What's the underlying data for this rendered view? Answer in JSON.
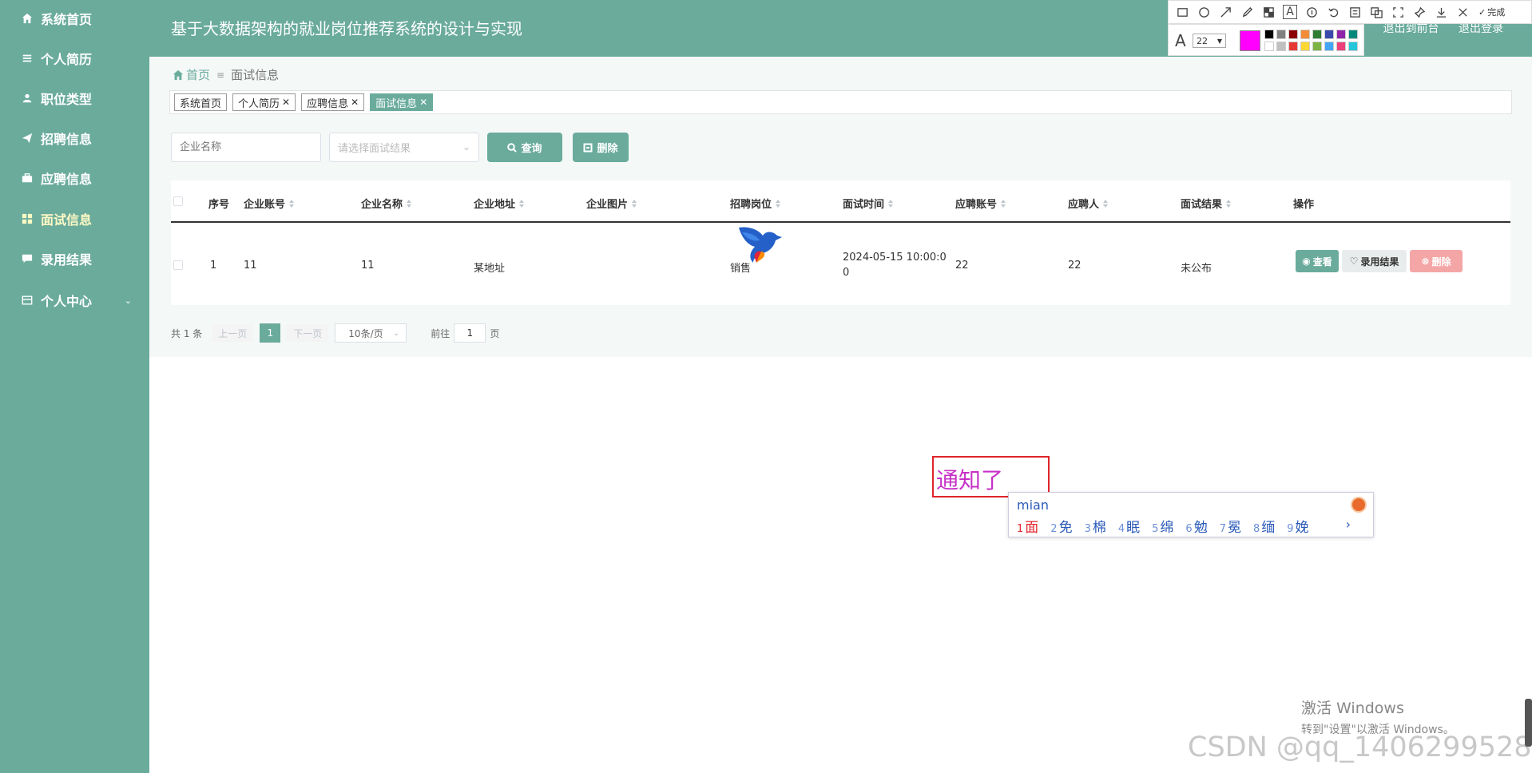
{
  "app": {
    "title": "基于大数据架构的就业岗位推荐系统的设计与实现",
    "header_links": [
      "退出到前台",
      "退出登录"
    ]
  },
  "sidebar": {
    "items": [
      {
        "label": "系统首页",
        "icon": "home-icon"
      },
      {
        "label": "个人简历",
        "icon": "list-icon"
      },
      {
        "label": "职位类型",
        "icon": "user-icon"
      },
      {
        "label": "招聘信息",
        "icon": "send-icon"
      },
      {
        "label": "应聘信息",
        "icon": "briefcase-icon"
      },
      {
        "label": "面试信息",
        "icon": "grid-icon",
        "active": true
      },
      {
        "label": "录用结果",
        "icon": "chat-icon"
      },
      {
        "label": "个人中心",
        "icon": "card-icon",
        "expandable": true
      }
    ]
  },
  "breadcrumb": {
    "home": "首页",
    "current": "面试信息"
  },
  "tags": [
    {
      "label": "系统首页",
      "closable": false
    },
    {
      "label": "个人简历",
      "closable": true
    },
    {
      "label": "应聘信息",
      "closable": true
    },
    {
      "label": "面试信息",
      "closable": true,
      "active": true
    }
  ],
  "search": {
    "company_placeholder": "企业名称",
    "result_placeholder": "请选择面试结果",
    "query_label": "查询",
    "delete_label": "删除"
  },
  "table": {
    "columns": [
      "序号",
      "企业账号",
      "企业名称",
      "企业地址",
      "企业图片",
      "招聘岗位",
      "面试时间",
      "应聘账号",
      "应聘人",
      "面试结果",
      "操作"
    ],
    "rows": [
      {
        "index": "1",
        "company_account": "11",
        "company_name": "11",
        "address": "某地址",
        "position": "销售",
        "time_line1": "2024-05-15 10:00:0",
        "time_line2": "0",
        "applicant_account": "22",
        "applicant": "22",
        "result": "未公布",
        "actions": [
          "查看",
          "录用结果",
          "删除"
        ]
      }
    ]
  },
  "pagination": {
    "total": "共 1 条",
    "prev": "上一页",
    "current": "1",
    "next": "下一页",
    "page_size": "10条/页",
    "goto_prefix": "前往",
    "goto_value": "1",
    "goto_suffix": "页"
  },
  "snip_tool": {
    "done_label": "完成",
    "font_size": "22",
    "current_color": "#ff00ff",
    "palette": [
      "#000000",
      "#808080",
      "#8b0000",
      "#f28c38",
      "#2e7d32",
      "#3949ab",
      "#8e24aa",
      "#00897b",
      "#ffffff",
      "#c0c0c0",
      "#e53935",
      "#fdd835",
      "#7cb342",
      "#42a5f5",
      "#ec407a",
      "#26c6da"
    ]
  },
  "annotation": {
    "text": "通知了",
    "border_color": "#e0242b",
    "text_color": "#c730c7"
  },
  "ime": {
    "input": "mian",
    "candidates": [
      {
        "n": "1",
        "c": "面"
      },
      {
        "n": "2",
        "c": "免"
      },
      {
        "n": "3",
        "c": "棉"
      },
      {
        "n": "4",
        "c": "眠"
      },
      {
        "n": "5",
        "c": "绵"
      },
      {
        "n": "6",
        "c": "勉"
      },
      {
        "n": "7",
        "c": "冕"
      },
      {
        "n": "8",
        "c": "缅"
      },
      {
        "n": "9",
        "c": "娩"
      }
    ]
  },
  "watermark": {
    "windows_line1": "激活 Windows",
    "windows_line2": "转到\"设置\"以激活 Windows。",
    "csdn": "CSDN @qq_1406299528"
  },
  "colors": {
    "primary": "#6aab9c",
    "danger": "#f4a6a6",
    "active_menu": "#fff9c4"
  }
}
